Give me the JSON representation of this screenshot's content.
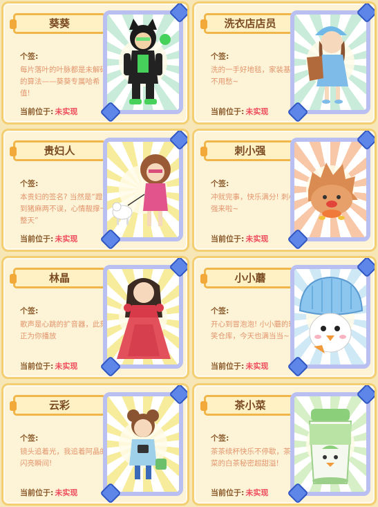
{
  "signature_label": "个签:",
  "location_label": "当前位于:",
  "characters": [
    {
      "name": "葵葵",
      "signature": "每片落叶的叶脉都是未解码的算法——葵葵专属哈希值!",
      "location": "未实现"
    },
    {
      "name": "洗衣店店员",
      "signature": "洗的一手好地毯，家装基调不用愁~",
      "location": "未实现"
    },
    {
      "name": "贵妇人",
      "signature": "本贵妇的签名? 当然是“蹬到猪麻两不误，心情靓撑一整天”",
      "location": "未实现"
    },
    {
      "name": "刺小强",
      "signature": "冲就完事，快乐满分! 刺小强来啦~",
      "location": "未实现"
    },
    {
      "name": "林晶",
      "signature": "歌声是心跳的扩音器，此刻正为你播放",
      "location": "未实现"
    },
    {
      "name": "小小蘑",
      "signature": "开心到冒泡泡! 小小蘑的玩笑仓库，今天也满当当~",
      "location": "未实现"
    },
    {
      "name": "云彩",
      "signature": "镜头追着光，我追着阿晶的闪亮瞬间!",
      "location": "未实现"
    },
    {
      "name": "茶小菜",
      "signature": "茶茶续杯快乐不停歇，茶小菜的白茶秘密超甜溢!",
      "location": "未实现"
    }
  ],
  "colors": {
    "label": "#8a5a2b",
    "signature": "#e2956c",
    "status": "#ef4c5b",
    "frame": "#b9bff0",
    "gem": "#5d86e8"
  }
}
